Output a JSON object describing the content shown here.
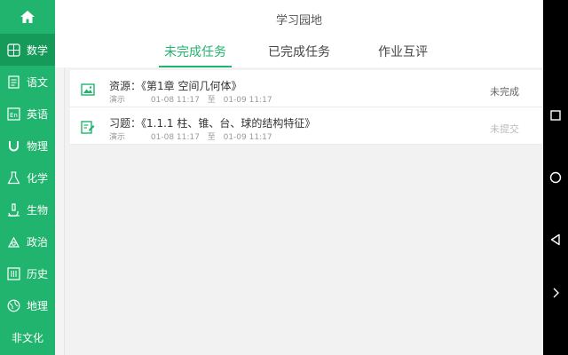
{
  "header": {
    "title": "学习园地",
    "tabs": [
      {
        "label": "未完成任务",
        "active": true
      },
      {
        "label": "已完成任务",
        "active": false
      },
      {
        "label": "作业互评",
        "active": false
      }
    ]
  },
  "sidebar": {
    "home_icon": "home-icon",
    "items": [
      {
        "label": "数学",
        "icon": "grid-calc-icon"
      },
      {
        "label": "语文",
        "icon": "book-text-icon"
      },
      {
        "label": "英语",
        "icon": "en-letter-icon"
      },
      {
        "label": "物理",
        "icon": "magnet-icon"
      },
      {
        "label": "化学",
        "icon": "flask-icon"
      },
      {
        "label": "生物",
        "icon": "microscope-icon"
      },
      {
        "label": "政治",
        "icon": "balance-icon"
      },
      {
        "label": "历史",
        "icon": "columns-icon"
      },
      {
        "label": "地理",
        "icon": "globe-icon"
      },
      {
        "label": "非文化",
        "icon": ""
      }
    ],
    "active_index": 0
  },
  "tasks": [
    {
      "icon": "image-icon",
      "title": "资源：《第1章 空间几何体》",
      "author": "演示",
      "start": "01-08 11:17",
      "sep": "至",
      "end": "01-09 11:17",
      "status": "未完成",
      "status_color": "#666666"
    },
    {
      "icon": "edit-document-icon",
      "title": "习题：《1.1.1 柱、锥、台、球的结构特征》",
      "author": "演示",
      "start": "01-08 11:17",
      "sep": "至",
      "end": "01-09 11:17",
      "status": "未提交",
      "status_color": "#bbbbbb"
    }
  ],
  "colors": {
    "accent": "#21b46e",
    "sidebar_active": "#169a5a"
  }
}
